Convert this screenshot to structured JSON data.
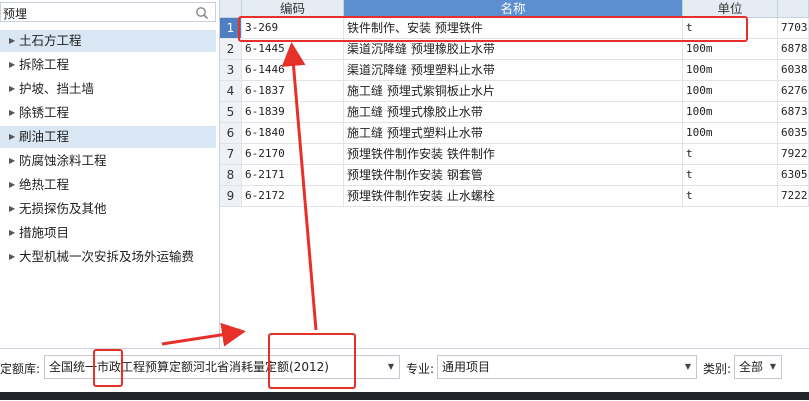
{
  "search": {
    "value": "预埋"
  },
  "tree": {
    "items": [
      {
        "label": "土石方工程",
        "selected": true
      },
      {
        "label": "拆除工程",
        "selected": false
      },
      {
        "label": "护坡、挡土墙",
        "selected": false
      },
      {
        "label": "除锈工程",
        "selected": false
      },
      {
        "label": "刷油工程",
        "selected": true
      },
      {
        "label": "防腐蚀涂料工程",
        "selected": false
      },
      {
        "label": "绝热工程",
        "selected": false
      },
      {
        "label": "无损探伤及其他",
        "selected": false
      },
      {
        "label": "措施项目",
        "selected": false
      },
      {
        "label": "大型机械一次安拆及场外运输费",
        "selected": false
      }
    ]
  },
  "table": {
    "headers": {
      "code": "编码",
      "name": "名称",
      "unit": "单位"
    },
    "rows": [
      {
        "num": "1",
        "code": "3-269",
        "name": "铁件制作、安装 预埋铁件",
        "unit": "t",
        "price": "7703"
      },
      {
        "num": "2",
        "code": "6-1445",
        "name": "渠道沉降缝 预埋橡胶止水带",
        "unit": "100m",
        "price": "6878"
      },
      {
        "num": "3",
        "code": "6-1446",
        "name": "渠道沉降缝 预埋塑料止水带",
        "unit": "100m",
        "price": "6038"
      },
      {
        "num": "4",
        "code": "6-1837",
        "name": "施工缝 预埋式紫铜板止水片",
        "unit": "100m",
        "price": "6276"
      },
      {
        "num": "5",
        "code": "6-1839",
        "name": "施工缝 预埋式橡胶止水带",
        "unit": "100m",
        "price": "6873"
      },
      {
        "num": "6",
        "code": "6-1840",
        "name": "施工缝 预埋式塑料止水带",
        "unit": "100m",
        "price": "6035"
      },
      {
        "num": "7",
        "code": "6-2170",
        "name": "预埋铁件制作安装 铁件制作",
        "unit": "t",
        "price": "7922"
      },
      {
        "num": "8",
        "code": "6-2171",
        "name": "预埋铁件制作安装 钢套管",
        "unit": "t",
        "price": "6305"
      },
      {
        "num": "9",
        "code": "6-2172",
        "name": "预埋铁件制作安装 止水螺栓",
        "unit": "t",
        "price": "7222"
      }
    ]
  },
  "bottom": {
    "library_label": "定额库:",
    "library_value": "全国统一市政工程预算定额河北省消耗量定额(2012)",
    "specialty_label": "专业:",
    "specialty_value": "通用项目",
    "category_label": "类别:",
    "category_value": "全部"
  },
  "colors": {
    "accent": "#5b8fd0",
    "annotation": "#e8302a",
    "selected_row": "#d9e7f5"
  }
}
